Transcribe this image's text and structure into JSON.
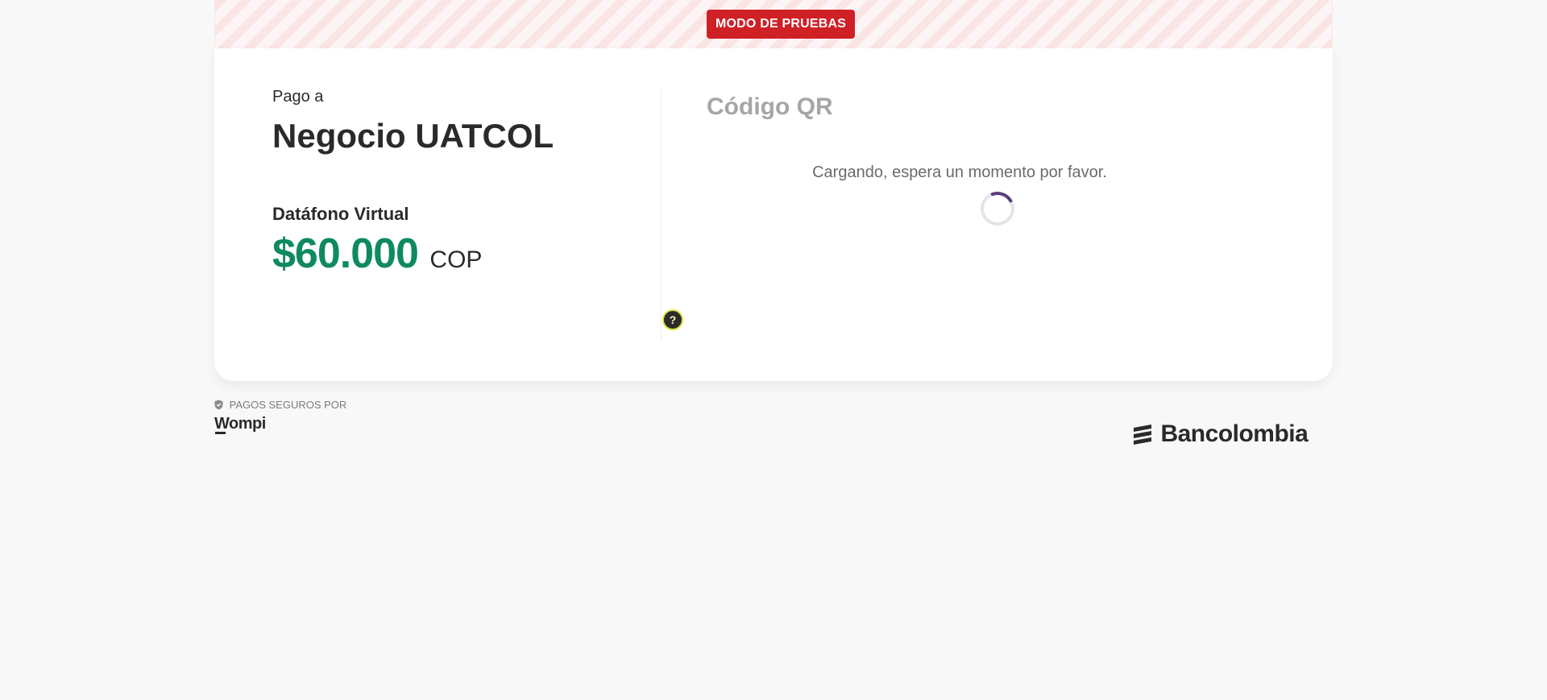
{
  "banner": {
    "badge_label": "MODO DE PRUEBAS"
  },
  "payment": {
    "pay_to_label": "Pago a",
    "merchant_name": "Negocio UATCOL",
    "product_label": "Datáfono Virtual",
    "amount": "$60.000",
    "currency": "COP",
    "help_label": "?"
  },
  "qr": {
    "title": "Código QR",
    "loading_text": "Cargando, espera un momento por favor."
  },
  "footer": {
    "secure_label": "PAGOS SEGUROS POR",
    "wompi_logo": "Wompi",
    "bancolombia_logo": "Bancolombia"
  },
  "colors": {
    "badge_red": "#cf2026",
    "amount_green": "#0e8a5f",
    "spinner_accent": "#5c3b7a",
    "help_ring": "#dfe43a"
  },
  "icons": {
    "shield": "shield-icon",
    "help": "question-icon",
    "spinner": "loading-spinner"
  }
}
